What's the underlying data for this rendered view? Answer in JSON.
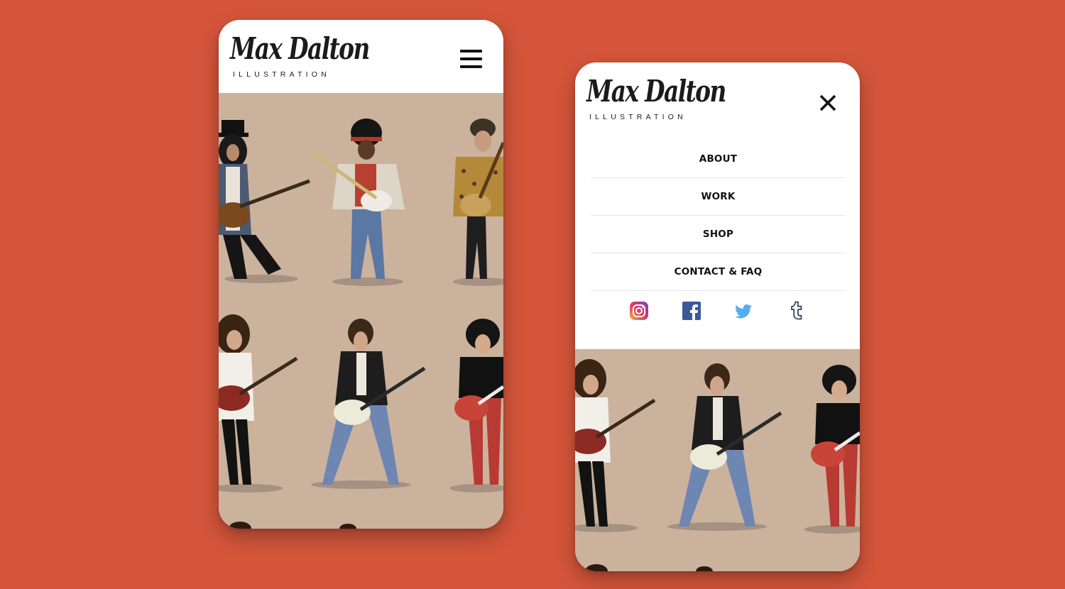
{
  "brand": {
    "script": "Max Dalton",
    "subtitle": "ILLUSTRATION"
  },
  "left_screen": {
    "menu_icon": "hamburger-menu-icon"
  },
  "right_screen": {
    "close_icon": "close-icon",
    "menu": [
      "ABOUT",
      "WORK",
      "SHOP",
      "CONTACT & FAQ"
    ],
    "social_icons": [
      "instagram-icon",
      "facebook-icon",
      "twitter-icon",
      "tumblr-icon"
    ]
  },
  "colors": {
    "background": "#d4553a",
    "artwork_paper": "#cbb29d",
    "instagram": "#c13584",
    "facebook": "#3b5998",
    "twitter": "#55acee",
    "tumblr": "#35465c"
  }
}
